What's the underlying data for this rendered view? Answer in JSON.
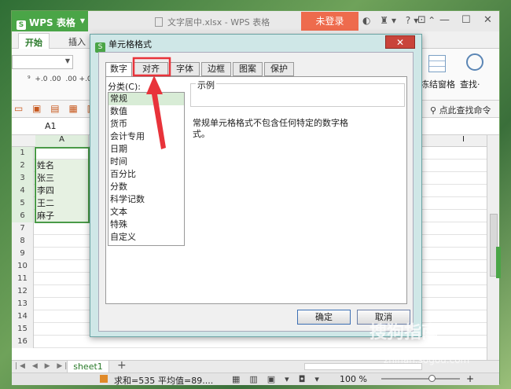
{
  "app": {
    "name": "WPS 表格",
    "file_title": "文字居中.xlsx - WPS 表格",
    "login": "未登录"
  },
  "ribbon": {
    "tabs": [
      "开始",
      "插入"
    ],
    "freeze_label": "冻结窗格",
    "find_label": "查找·",
    "quick_find": "点此查找命令"
  },
  "formula_bar": {
    "cell_ref": "A1"
  },
  "grid": {
    "col_a": "A",
    "col_i": "I",
    "rows": [
      {
        "n": "1",
        "a": ""
      },
      {
        "n": "2",
        "a": "姓名"
      },
      {
        "n": "3",
        "a": "张三"
      },
      {
        "n": "4",
        "a": "李四"
      },
      {
        "n": "5",
        "a": "王二"
      },
      {
        "n": "6",
        "a": "麻子"
      },
      {
        "n": "7",
        "a": ""
      },
      {
        "n": "8",
        "a": ""
      },
      {
        "n": "9",
        "a": ""
      },
      {
        "n": "10",
        "a": ""
      },
      {
        "n": "11",
        "a": ""
      },
      {
        "n": "12",
        "a": ""
      },
      {
        "n": "13",
        "a": ""
      },
      {
        "n": "14",
        "a": ""
      },
      {
        "n": "15",
        "a": ""
      },
      {
        "n": "16",
        "a": ""
      }
    ]
  },
  "sheets": {
    "active": "sheet1"
  },
  "status": {
    "sum": "求和=535",
    "avg": "平均值=89....",
    "zoom": "100 %"
  },
  "dialog": {
    "title": "单元格格式",
    "tabs": [
      "数字",
      "对齐",
      "字体",
      "边框",
      "图案",
      "保护"
    ],
    "category_label": "分类(C):",
    "categories": [
      "常规",
      "数值",
      "货币",
      "会计专用",
      "日期",
      "时间",
      "百分比",
      "分数",
      "科学记数",
      "文本",
      "特殊",
      "自定义"
    ],
    "sample_label": "示例",
    "description": "常规单元格格式不包含任何特定的数字格式。",
    "ok": "确定",
    "cancel": "取消"
  },
  "watermark": {
    "line1": "搜狗指南",
    "line2": "zhinan.sogou.com"
  },
  "colors": {
    "accent": "#4aa547",
    "login": "#ee6b4d",
    "annotation": "#e8333a"
  }
}
